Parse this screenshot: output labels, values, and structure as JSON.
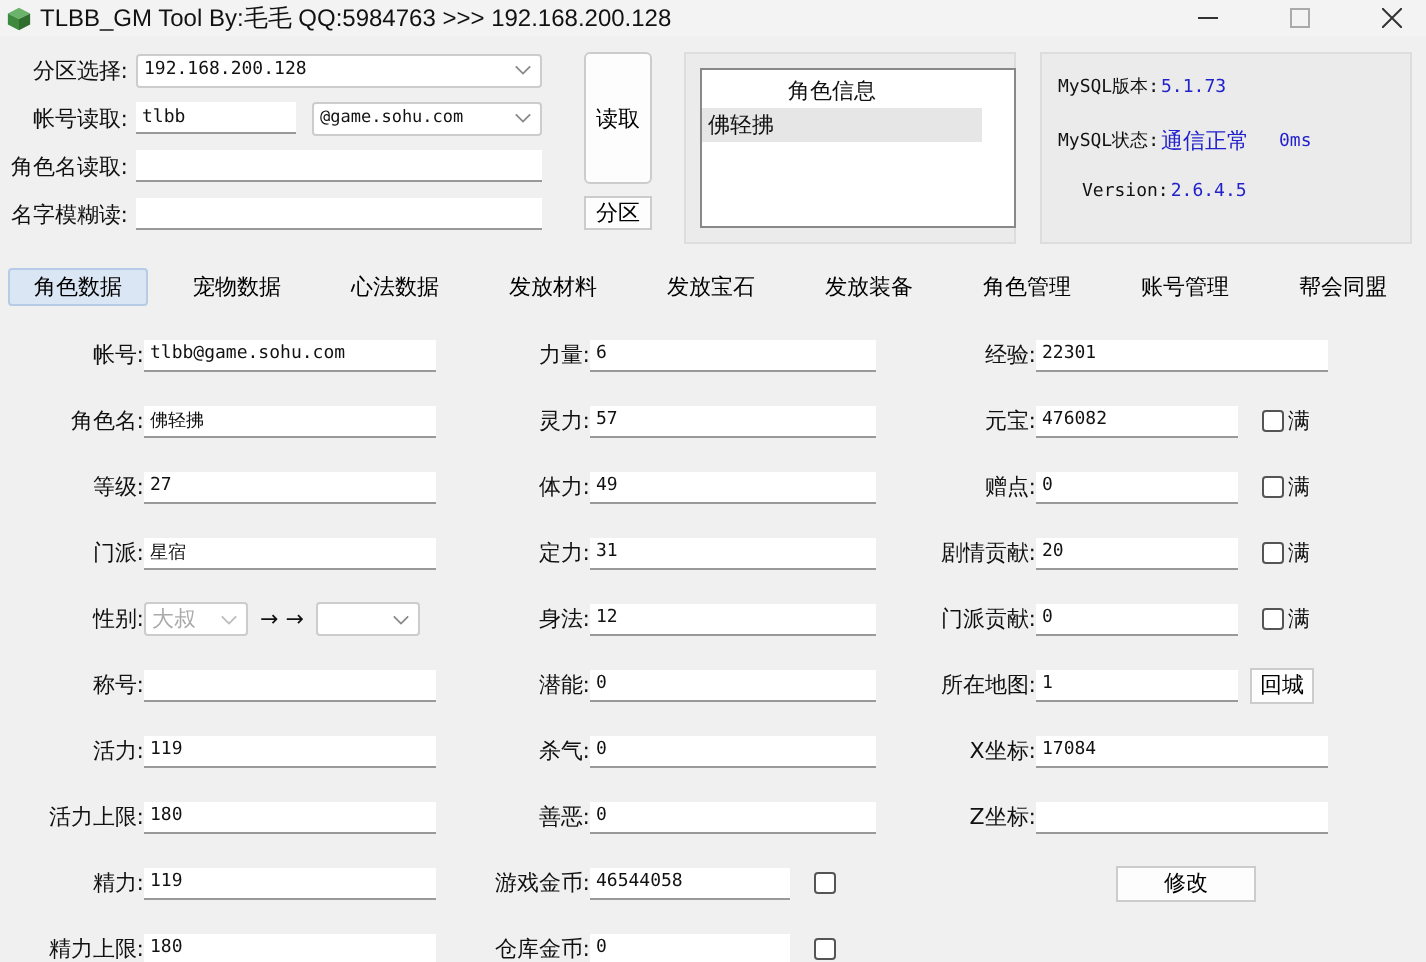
{
  "window": {
    "title": "TLBB_GM Tool By:毛毛 QQ:5984763 >>> 192.168.200.128"
  },
  "header": {
    "server": {
      "label": "分区选择:",
      "value": "192.168.200.128"
    },
    "account": {
      "label": "帐号读取:",
      "value": "tlbb",
      "domain": "@game.sohu.com"
    },
    "role_name": {
      "label": "角色名读取:"
    },
    "fuzzy_name": {
      "label": "名字模糊读:"
    },
    "read_button": "读取",
    "zone_button": "分区"
  },
  "role_list": {
    "header": "角色信息",
    "rows": [
      {
        "name": "佛轻拂",
        "selected": true
      }
    ]
  },
  "mysql": [
    {
      "label": "MySQL版本:",
      "value": "5.1.73"
    },
    {
      "label": "MySQL状态:",
      "value": "通信正常",
      "extra": "0ms"
    },
    {
      "label": "Version:",
      "value": "2.6.4.5"
    }
  ],
  "tabs": [
    {
      "label": "角色数据",
      "selected": true
    },
    {
      "label": "宠物数据",
      "selected": false
    },
    {
      "label": "心法数据",
      "selected": false
    },
    {
      "label": "发放材料",
      "selected": false
    },
    {
      "label": "发放宝石",
      "selected": false
    },
    {
      "label": "发放装备",
      "selected": false
    },
    {
      "label": "角色管理",
      "selected": false
    },
    {
      "label": "账号管理",
      "selected": false
    },
    {
      "label": "帮会同盟",
      "selected": false
    }
  ],
  "rows": [
    [
      {
        "kind": "text",
        "label": "帐号:",
        "value": "tlbb@game.sohu.com"
      },
      {
        "kind": "text",
        "label": "力量:",
        "value": "6"
      },
      {
        "kind": "wide",
        "label": "经验:",
        "value": "22301"
      }
    ],
    [
      {
        "kind": "text",
        "label": "角色名:",
        "value": "佛轻拂"
      },
      {
        "kind": "text",
        "label": "灵力:",
        "value": "57"
      },
      {
        "kind": "check",
        "label": "元宝:",
        "value": "476082",
        "check": "满",
        "checked": false
      }
    ],
    [
      {
        "kind": "text",
        "label": "等级:",
        "value": "27"
      },
      {
        "kind": "text",
        "label": "体力:",
        "value": "49"
      },
      {
        "kind": "check",
        "label": "赠点:",
        "value": "0",
        "check": "满",
        "checked": false
      }
    ],
    [
      {
        "kind": "text",
        "label": "门派:",
        "value": "星宿"
      },
      {
        "kind": "text",
        "label": "定力:",
        "value": "31"
      },
      {
        "kind": "check",
        "label": "剧情贡献:",
        "value": "20",
        "check": "满",
        "checked": false
      }
    ],
    [
      {
        "kind": "gender",
        "label": "性别:",
        "value": "大叔",
        "arrow": "→ →"
      },
      {
        "kind": "text",
        "label": "身法:",
        "value": "12"
      },
      {
        "kind": "check",
        "label": "门派贡献:",
        "value": "0",
        "check": "满",
        "checked": false
      }
    ],
    [
      {
        "kind": "text",
        "label": "称号:"
      },
      {
        "kind": "text",
        "label": "潜能:",
        "value": "0"
      },
      {
        "kind": "map",
        "label": "所在地图:",
        "value": "1",
        "button": "回城"
      }
    ],
    [
      {
        "kind": "text",
        "label": "活力:",
        "value": "119"
      },
      {
        "kind": "text",
        "label": "杀气:",
        "value": "0"
      },
      {
        "kind": "wide",
        "label": "X坐标:",
        "value": "17084"
      }
    ],
    [
      {
        "kind": "text",
        "label": "活力上限:",
        "value": "180"
      },
      {
        "kind": "text",
        "label": "善恶:",
        "value": "0"
      },
      {
        "kind": "wide",
        "label": "Z坐标:"
      }
    ],
    [
      {
        "kind": "text",
        "label": "精力:",
        "value": "119"
      },
      {
        "kind": "check",
        "label": "游戏金币:",
        "value": "46544058",
        "checked": false
      },
      {
        "kind": "button",
        "button": "修改"
      }
    ],
    [
      {
        "kind": "text",
        "label": "精力上限:",
        "value": "180"
      },
      {
        "kind": "check",
        "label": "仓库金币:",
        "value": "0",
        "checked": false
      },
      {
        "kind": "empty"
      }
    ]
  ]
}
